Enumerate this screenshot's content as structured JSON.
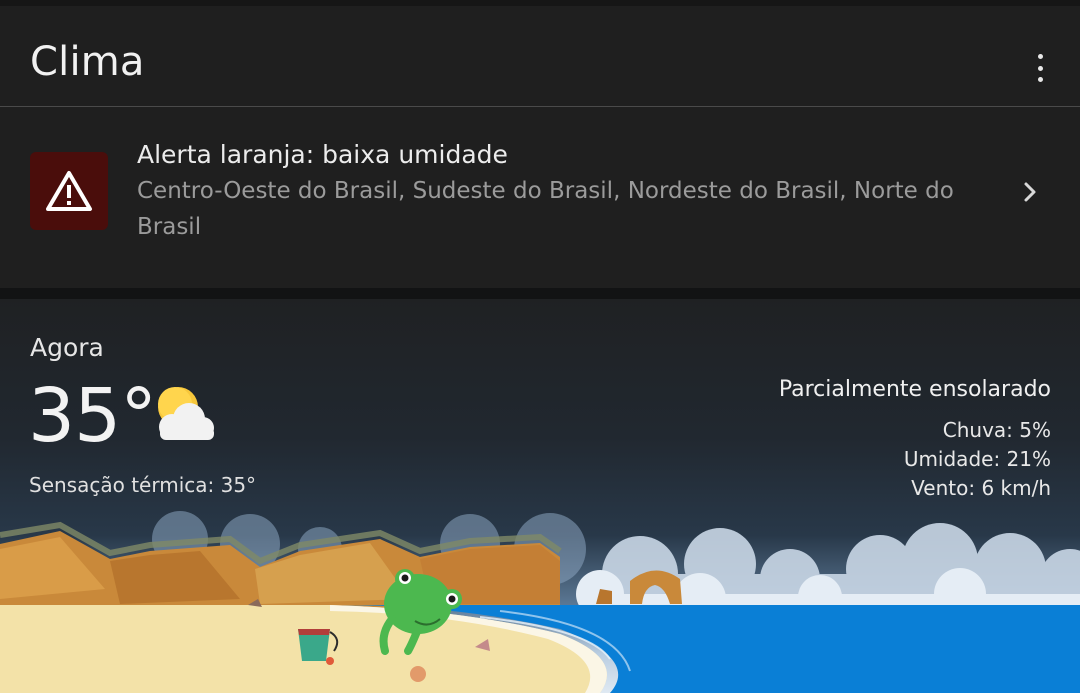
{
  "header": {
    "title": "Clima",
    "menu_icon": "more-vert-icon"
  },
  "alert": {
    "icon": "warning-icon",
    "title": "Alerta laranja: baixa umidade",
    "regions": "Centro-Oeste do Brasil, Sudeste do Brasil, Nordeste do Brasil, Norte do Brasil",
    "chevron_icon": "chevron-right-icon",
    "accent_color": "#4a0d0b"
  },
  "current": {
    "label": "Agora",
    "temperature": "35°",
    "condition_icon": "partly-sunny-icon",
    "feels_like": "Sensação térmica: 35°",
    "condition": "Parcialmente ensolarado",
    "rain": "Chuva: 5%",
    "humidity": "Umidade: 21%",
    "wind": "Vento: 6 km/h"
  },
  "illustration": "beach-scene-with-frog"
}
